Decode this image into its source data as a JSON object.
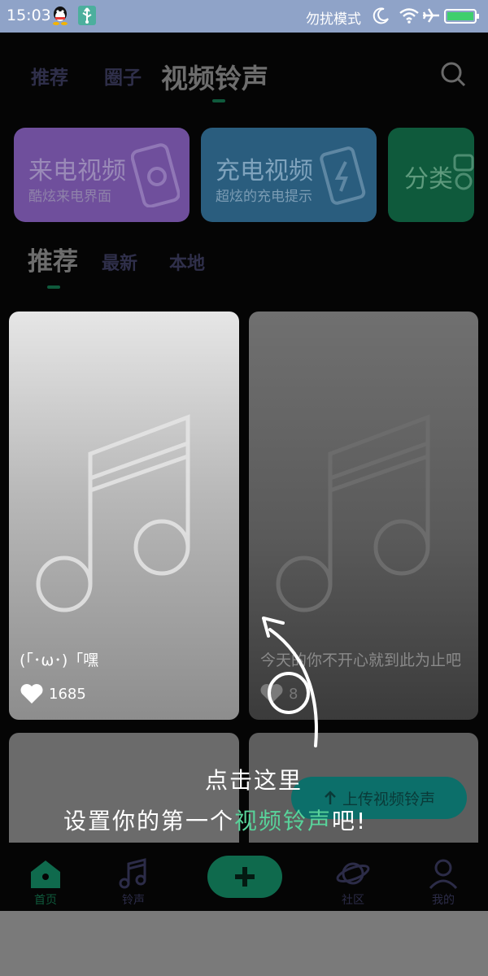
{
  "status_bar": {
    "time": "15:03",
    "dnd_text": "勿扰模式",
    "icons": [
      "qq-icon",
      "usb-icon",
      "moon-icon",
      "wifi-icon",
      "airplane-icon",
      "battery-icon"
    ]
  },
  "top_tabs": [
    {
      "label": "推荐",
      "active": false
    },
    {
      "label": "圈子",
      "active": false
    },
    {
      "label": "视频铃声",
      "active": true
    }
  ],
  "banners": [
    {
      "title": "来电视频",
      "subtitle": "酷炫来电界面",
      "color": "#6f4f9c"
    },
    {
      "title": "充电视频",
      "subtitle": "超炫的充电提示",
      "color": "#2a5d7e"
    },
    {
      "title": "分类",
      "subtitle": "",
      "color": "#0f5a3c"
    }
  ],
  "content_tabs": [
    {
      "label": "推荐",
      "active": true
    },
    {
      "label": "最新",
      "active": false
    },
    {
      "label": "本地",
      "active": false
    }
  ],
  "cards": [
    {
      "caption": "(「･ω･)「嘿",
      "likes": "1685"
    },
    {
      "caption": "今天的你不开心就到此为止吧",
      "likes": "8"
    }
  ],
  "upload_button": {
    "icon": "upload-icon",
    "label": "上传视频铃声"
  },
  "bottom_nav": [
    {
      "label": "首页",
      "icon": "home-icon",
      "active": true
    },
    {
      "label": "铃声",
      "icon": "music-note-icon",
      "active": false
    },
    {
      "label": "",
      "icon": "plus-icon",
      "active": false
    },
    {
      "label": "社区",
      "icon": "planet-icon",
      "active": false
    },
    {
      "label": "我的",
      "icon": "user-icon",
      "active": false
    }
  ],
  "guide": {
    "line1": "点击这里",
    "line2_prefix": "设置你的第一个",
    "line2_highlight": "视频铃声",
    "line2_suffix": "吧!"
  },
  "colors": {
    "accent": "#0f6a4d",
    "highlight": "#58d39a",
    "status_bar": "#8fa3c8"
  }
}
